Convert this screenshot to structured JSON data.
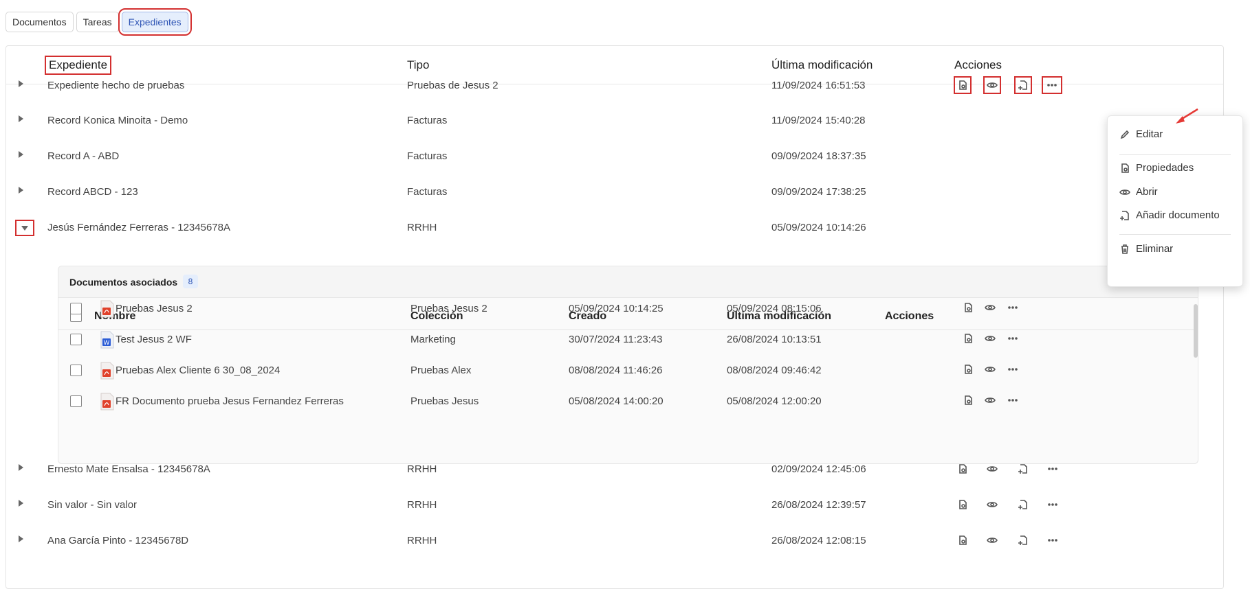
{
  "tabs": [
    "Documentos",
    "Tareas",
    "Expedientes"
  ],
  "columns": {
    "expediente": "Expediente",
    "tipo": "Tipo",
    "ultima": "Última modificación",
    "acciones": "Acciones"
  },
  "rows": [
    {
      "name": "Expediente hecho de pruebas",
      "tipo": "Pruebas de Jesus 2",
      "fecha": "11/09/2024 16:51:53"
    },
    {
      "name": "Record Konica Minoita - Demo",
      "tipo": "Facturas",
      "fecha": "11/09/2024 15:40:28"
    },
    {
      "name": "Record A - ABD",
      "tipo": "Facturas",
      "fecha": "09/09/2024 18:37:35"
    },
    {
      "name": "Record ABCD - 123",
      "tipo": "Facturas",
      "fecha": "09/09/2024 17:38:25"
    },
    {
      "name": "Jesús Fernández Ferreras - 12345678A",
      "tipo": "RRHH",
      "fecha": "05/09/2024 10:14:26"
    },
    {
      "name": "Ernesto Mate Ensalsa - 12345678A",
      "tipo": "RRHH",
      "fecha": "02/09/2024 12:45:06"
    },
    {
      "name": "Sin valor - Sin valor",
      "tipo": "RRHH",
      "fecha": "26/08/2024 12:39:57"
    },
    {
      "name": "Ana García Pinto - 12345678D",
      "tipo": "RRHH",
      "fecha": "26/08/2024 12:08:15"
    }
  ],
  "sub": {
    "title": "Documentos asociados",
    "count": "8",
    "columns": {
      "nombre": "Nombre",
      "coleccion": "Colección",
      "creado": "Creado",
      "ultima": "Última modificación",
      "acciones": "Acciones"
    },
    "rows": [
      {
        "name": "Pruebas Jesus 2",
        "file": "pdf",
        "coleccion": "Pruebas Jesus 2",
        "creado": "05/09/2024 10:14:25",
        "mod": "05/09/2024 08:15:06"
      },
      {
        "name": "Test Jesus 2 WF",
        "file": "word",
        "coleccion": "Marketing",
        "creado": "30/07/2024 11:23:43",
        "mod": "26/08/2024 10:13:51"
      },
      {
        "name": "Pruebas Alex Cliente 6 30_08_2024",
        "file": "pdf",
        "coleccion": "Pruebas Alex",
        "creado": "08/08/2024 11:46:26",
        "mod": "08/08/2024 09:46:42"
      },
      {
        "name": "FR Documento prueba Jesus Fernandez Ferreras",
        "file": "pdf",
        "coleccion": "Pruebas Jesus",
        "creado": "05/08/2024 14:00:20",
        "mod": "05/08/2024 12:00:20"
      }
    ]
  },
  "menu": {
    "editar": "Editar",
    "propiedades": "Propiedades",
    "abrir": "Abrir",
    "anadir": "Añadir documento",
    "eliminar": "Eliminar"
  },
  "icons": [
    "properties-icon",
    "eye-icon",
    "add-document-icon",
    "more-icon"
  ],
  "colors": {
    "accent": "#2f55b5",
    "highlight": "#d32f2f"
  }
}
